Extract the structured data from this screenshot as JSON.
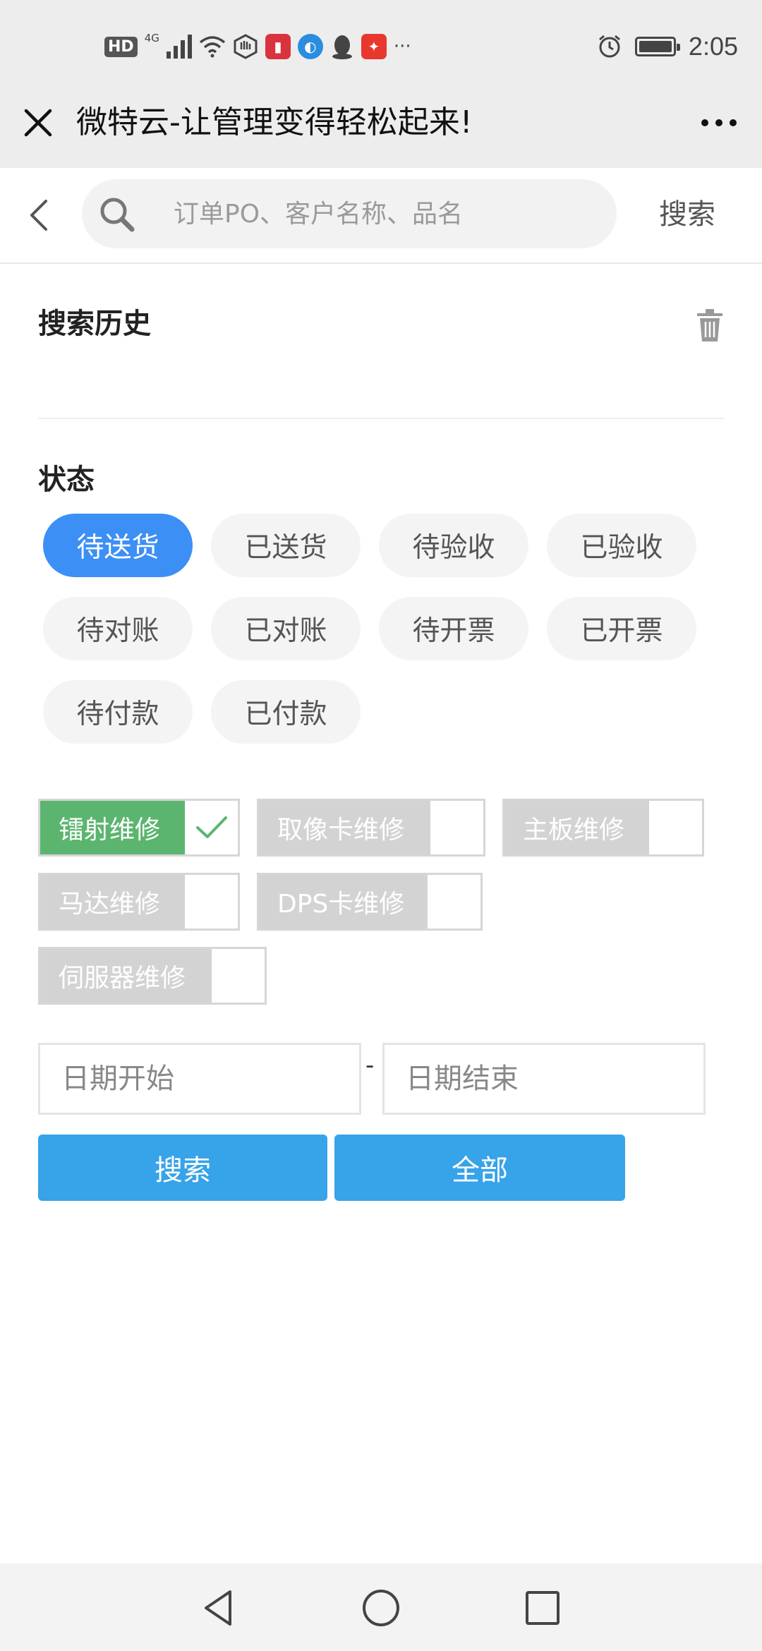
{
  "status_bar": {
    "hd": "HD",
    "signal": "4G",
    "time": "2:05",
    "overflow": "···",
    "icons": [
      "wifi-icon",
      "vpn-icon",
      "book-app-icon",
      "browser-app-icon",
      "qq-icon",
      "game-app-icon",
      "alarm-icon",
      "battery-icon"
    ]
  },
  "title_bar": {
    "title": "微特云-让管理变得轻松起来!"
  },
  "search": {
    "placeholder": "订单PO、客户名称、品名",
    "button_label": "搜索"
  },
  "history": {
    "title": "搜索历史"
  },
  "status": {
    "title": "状态",
    "chips": [
      {
        "label": "待送货",
        "active": true
      },
      {
        "label": "已送货",
        "active": false
      },
      {
        "label": "待验收",
        "active": false
      },
      {
        "label": "已验收",
        "active": false
      },
      {
        "label": "待对账",
        "active": false
      },
      {
        "label": "已对账",
        "active": false
      },
      {
        "label": "待开票",
        "active": false
      },
      {
        "label": "已开票",
        "active": false
      },
      {
        "label": "待付款",
        "active": false
      },
      {
        "label": "已付款",
        "active": false
      }
    ]
  },
  "repair_types": [
    {
      "label": "镭射维修",
      "checked": true
    },
    {
      "label": "取像卡维修",
      "checked": false
    },
    {
      "label": "主板维修",
      "checked": false
    },
    {
      "label": "马达维修",
      "checked": false
    },
    {
      "label": "DPS卡维修",
      "checked": false
    },
    {
      "label": "伺服器维修",
      "checked": false
    }
  ],
  "date_range": {
    "start_placeholder": "日期开始",
    "separator": "-",
    "end_placeholder": "日期结束"
  },
  "actions": {
    "search_label": "搜索",
    "all_label": "全部"
  },
  "colors": {
    "accent_blue": "#3c8ff5",
    "button_blue": "#37a3e8",
    "check_green": "#5cb56f",
    "chip_bg": "#f4f4f4"
  }
}
